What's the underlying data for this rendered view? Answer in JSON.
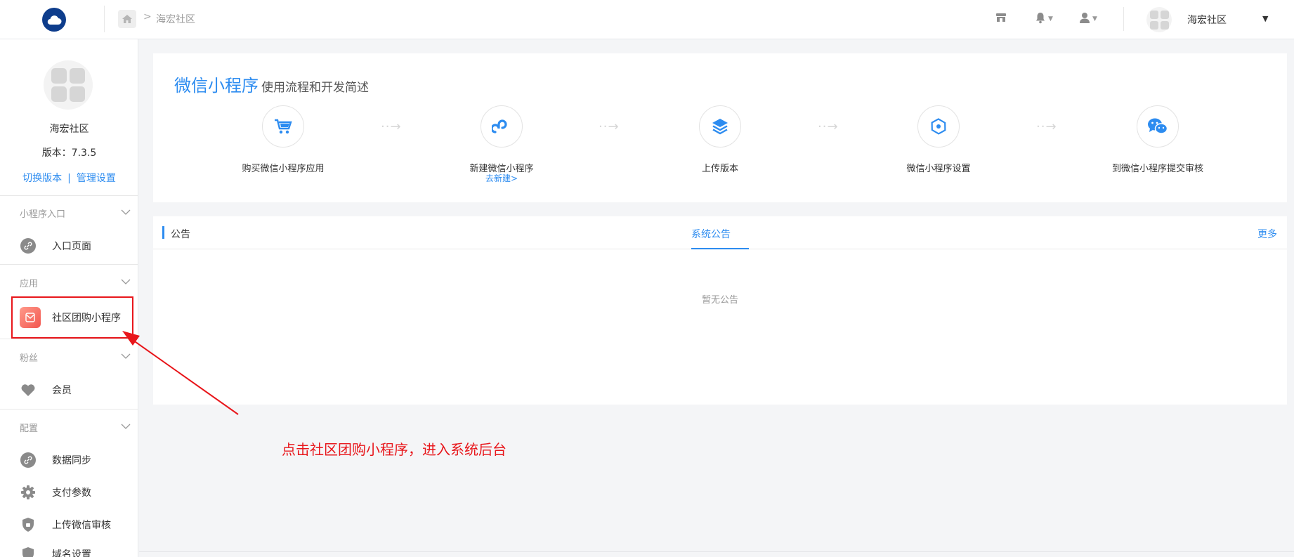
{
  "header": {
    "breadcrumb": [
      "海宏社区"
    ],
    "user_name": "海宏社区",
    "icons": [
      "cloud-logo-icon",
      "home-icon",
      "store-icon",
      "bell-icon",
      "user-icon",
      "caret-down-icon"
    ]
  },
  "sidebar": {
    "org_name": "海宏社区",
    "version": "版本：7.3.5",
    "links": [
      "切换版本",
      "管理设置"
    ],
    "groups": [
      {
        "title": "小程序入口",
        "items": [
          {
            "label": "入口页面",
            "icon": "link-icon"
          }
        ]
      },
      {
        "title": "应用",
        "items": [
          {
            "label": "社区团购小程序",
            "icon": "app-mail-icon"
          }
        ]
      },
      {
        "title": "粉丝",
        "items": [
          {
            "label": "会员",
            "icon": "heart-icon"
          }
        ]
      },
      {
        "title": "配置",
        "items": [
          {
            "label": "数据同步",
            "icon": "link-icon"
          },
          {
            "label": "支付参数",
            "icon": "gear-icon"
          },
          {
            "label": "上传微信审核",
            "icon": "shield-icon"
          },
          {
            "label": "域名设置",
            "icon": "globe-icon"
          }
        ]
      }
    ]
  },
  "flow": {
    "title": "微信小程序",
    "subtitle": "使用流程和开发简述",
    "steps": [
      {
        "label": "购买微信小程序应用",
        "icon": "cart-icon"
      },
      {
        "label": "新建微信小程序",
        "link": "去新建>",
        "icon": "miniprogram-icon"
      },
      {
        "label": "上传版本",
        "icon": "layers-icon"
      },
      {
        "label": "微信小程序设置",
        "icon": "hexagon-icon"
      },
      {
        "label": "到微信小程序提交审核",
        "icon": "wechat-icon"
      }
    ],
    "arrow": "··→"
  },
  "notice": {
    "title": "公告",
    "tab": "系统公告",
    "more": "更多",
    "empty": "暂无公告"
  },
  "annotation": {
    "text": "点击社区团购小程序，进入系统后台"
  },
  "colors": {
    "accent": "#2d8cf0",
    "annotation": "#e8161b",
    "logo": "#0e3d8c"
  }
}
